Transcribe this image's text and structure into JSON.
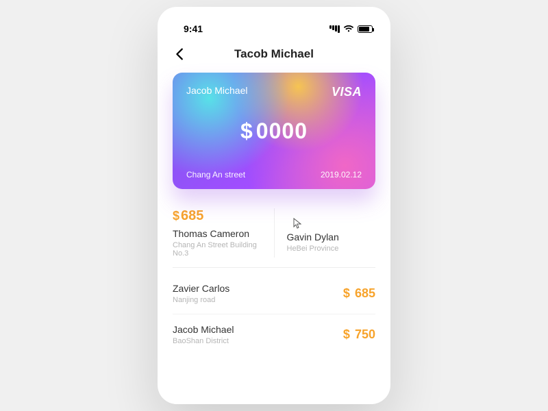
{
  "status": {
    "time": "9:41"
  },
  "header": {
    "title": "Tacob Michael"
  },
  "card": {
    "holder": "Jacob Michael",
    "brand": "VISA",
    "currency": "$",
    "amount": "0000",
    "address": "Chang An street",
    "date": "2019.02.12"
  },
  "featured": {
    "currency": "$",
    "amount": "685",
    "left": {
      "name": "Thomas Cameron",
      "sub": "Chang An Street Building No.3"
    },
    "right": {
      "name": "Gavin Dylan",
      "sub": "HeBei Province"
    }
  },
  "transactions": [
    {
      "name": "Zavier Carlos",
      "sub": "Nanjing road",
      "currency": "$",
      "amount": "685"
    },
    {
      "name": "Jacob Michael",
      "sub": "BaoShan District",
      "currency": "$",
      "amount": "750"
    }
  ],
  "colors": {
    "accent": "#f7a32b"
  }
}
